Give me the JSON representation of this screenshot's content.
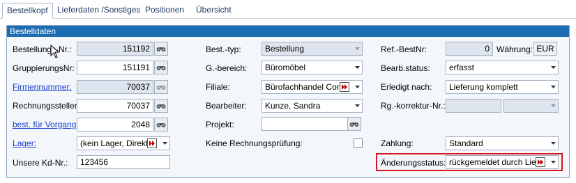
{
  "tabs": [
    "Bestellkopf",
    "Lieferdaten /Sonstiges",
    "Positionen",
    "Übersicht"
  ],
  "section_title": "Bestelldaten",
  "left": {
    "bestellungs_nr": {
      "label": "Bestellungs-Nr.:",
      "value": "151192"
    },
    "gruppierungs_nr": {
      "label": "GruppierungsNr:",
      "value": "151191"
    },
    "firmennummer": {
      "label": "Firmennummer:",
      "value": "70037"
    },
    "rechnungssteller": {
      "label": "Rechnungssteller:",
      "value": "70037"
    },
    "best_fuer_vorgang": {
      "label": "best. für Vorgang:",
      "value": "2048"
    },
    "lager": {
      "label": "Lager:",
      "value": "(kein Lager, Direktli"
    },
    "unsere_kd_nr": {
      "label": "Unsere Kd-Nr.:",
      "value": "123456"
    }
  },
  "middle": {
    "best_typ": {
      "label": "Best.-typ:",
      "value": "Bestellung"
    },
    "g_bereich": {
      "label": "G.-bereich:",
      "value": "Büromöbel"
    },
    "filiale": {
      "label": "Filiale:",
      "value": "Bürofachhandel Conc"
    },
    "bearbeiter": {
      "label": "Bearbeiter:",
      "value": "Kunze, Sandra"
    },
    "projekt": {
      "label": "Projekt:",
      "value": ""
    },
    "keine_rechnungspruefung": {
      "label": "Keine Rechnungsprüfung:",
      "checked": false
    }
  },
  "right": {
    "ref_best_nr": {
      "label": "Ref.-BestNr:",
      "value": "0"
    },
    "waehrung": {
      "label": "Währung:",
      "value": "EUR"
    },
    "bearb_status": {
      "label": "Bearb.status:",
      "value": "erfasst"
    },
    "erledigt_nach": {
      "label": "Erledigt nach:",
      "value": "Lieferung komplett"
    },
    "rg_korrektur_nr": {
      "label": "Rg.-korrektur-Nr.:",
      "value": ""
    },
    "zahlung": {
      "label": "Zahlung:",
      "value": "Standard"
    },
    "aenderungsstatus": {
      "label": "Änderungsstatus:",
      "value": "rückgemeldet durch Liefe"
    }
  },
  "colors": {
    "header": "#1d6db3",
    "highlight": "#d7171d",
    "link": "#1a3fcc"
  }
}
